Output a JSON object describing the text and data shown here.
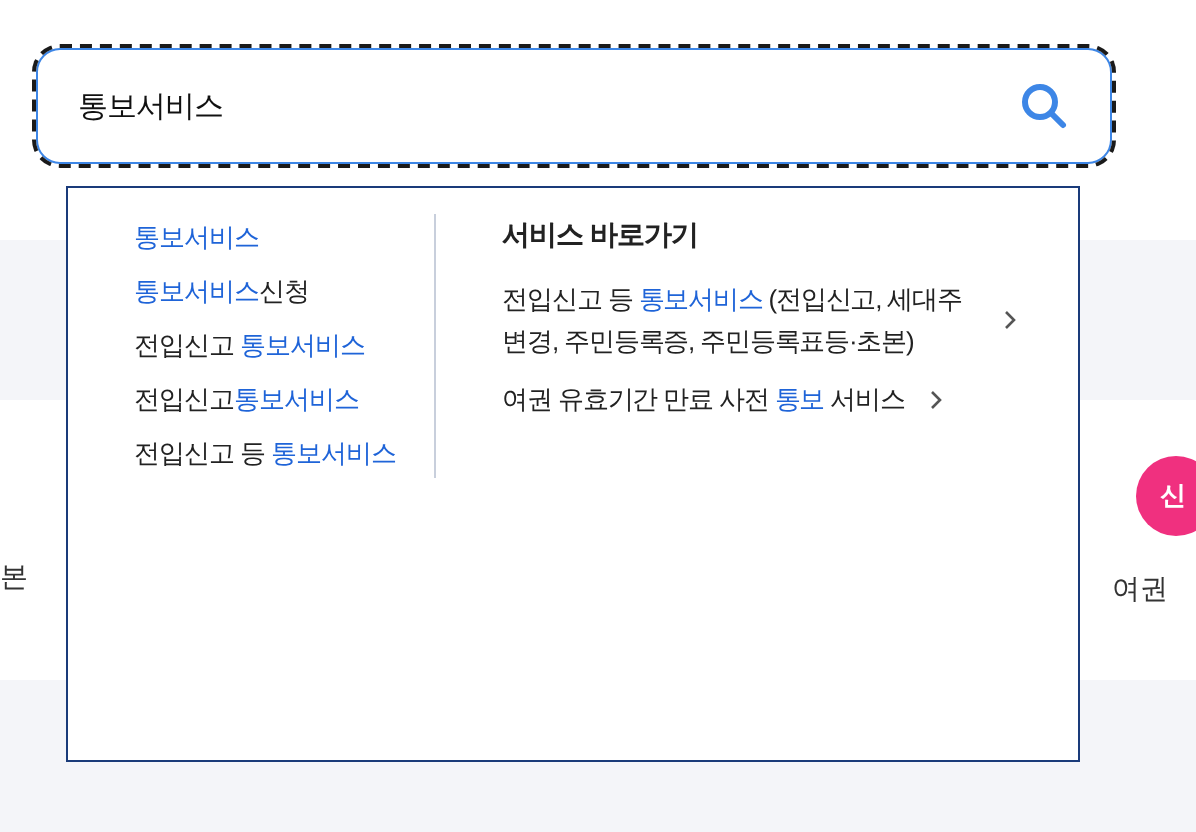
{
  "search": {
    "value": "통보서비스"
  },
  "suggestions": [
    [
      {
        "text": "통보서비스",
        "highlight": true
      }
    ],
    [
      {
        "text": "통보서비스",
        "highlight": true
      },
      {
        "text": "신청",
        "highlight": false
      }
    ],
    [
      {
        "text": "전입신고 ",
        "highlight": false
      },
      {
        "text": "통보서비스",
        "highlight": true
      }
    ],
    [
      {
        "text": "전입신고",
        "highlight": false
      },
      {
        "text": "통보서비스",
        "highlight": true
      }
    ],
    [
      {
        "text": "전입신고 등 ",
        "highlight": false
      },
      {
        "text": "통보서비스",
        "highlight": true
      }
    ]
  ],
  "shortcuts": {
    "title": "서비스 바로가기",
    "links": [
      [
        {
          "text": "전입신고 등 ",
          "highlight": false
        },
        {
          "text": "통보서비스",
          "highlight": true
        },
        {
          "text": " (전입신고, 세대주 변경, 주민등록증, 주민등록표등·초본)",
          "highlight": false
        }
      ],
      [
        {
          "text": "여권 유효기간 만료 사전 ",
          "highlight": false
        },
        {
          "text": "통보",
          "highlight": true
        },
        {
          "text": " 서비스",
          "highlight": false
        }
      ]
    ]
  },
  "background": {
    "left_text": "본",
    "badge": "신",
    "right_text": "여권"
  }
}
